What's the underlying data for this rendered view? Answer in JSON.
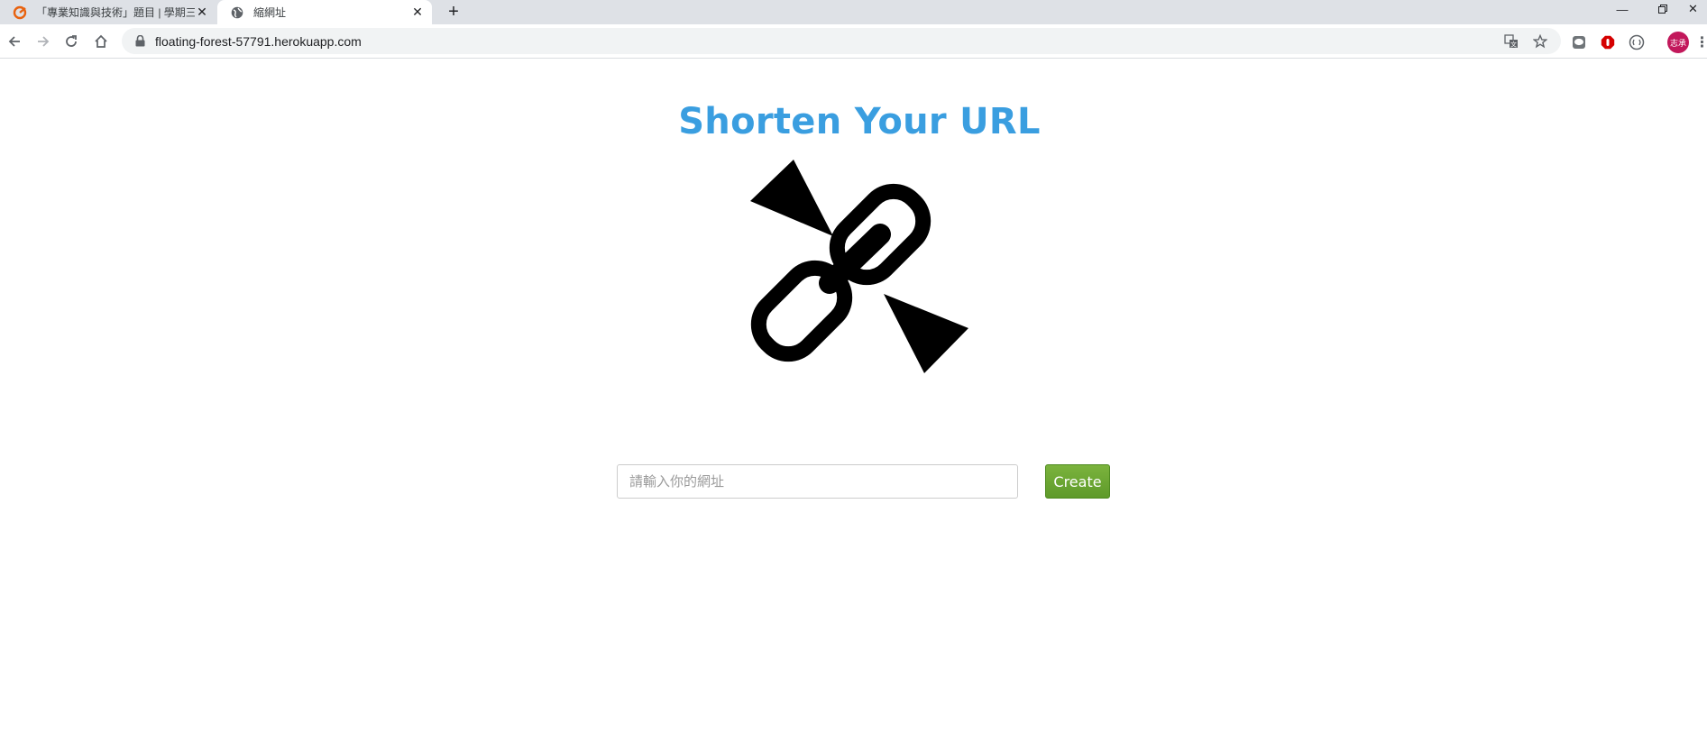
{
  "browser": {
    "tabs": [
      {
        "title": "「專業知識與技術」題目 | 學期三",
        "active": false,
        "icon": "brand-logo-icon"
      },
      {
        "title": "縮網址",
        "active": true,
        "icon": "globe-icon"
      }
    ],
    "address": "floating-forest-57791.herokuapp.com",
    "profile_initials": "志承"
  },
  "page": {
    "title": "Shorten Your URL",
    "input_placeholder": "請輸入你的網址",
    "input_value": "",
    "button_label": "Create"
  },
  "colors": {
    "title": "#3a9ee0",
    "button": "#6aa534",
    "profile": "#c2185b"
  }
}
